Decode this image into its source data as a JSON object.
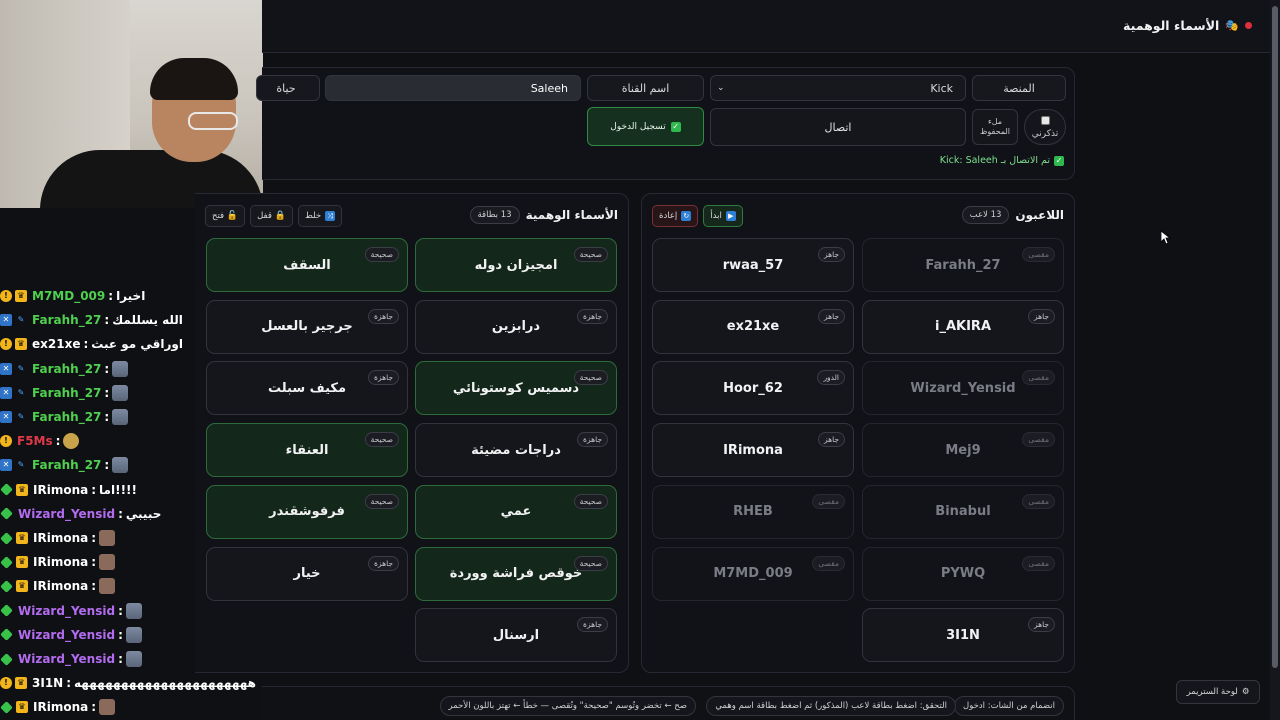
{
  "app": {
    "title": "الأسماء الوهمية"
  },
  "controls": {
    "platform_label": "المنصة",
    "platform_value": "Kick",
    "channel_label": "اسم القناة",
    "channel_value": "Saleeh",
    "clipped_field": "حياة",
    "remember_label": "تذكرني",
    "autosave_label": "ملء المحفوظ",
    "connect_label": "اتصال",
    "login_label": "تسجيل الدخول",
    "status": "تم الاتصال بـ Kick: Saleeh"
  },
  "players_panel": {
    "title": "اللاعبون",
    "count": "13 لاعب",
    "start_label": "ابدأ",
    "reset_label": "إعادة",
    "cards": [
      {
        "name": "Farahh_27",
        "status": "مقصى",
        "state": "faded"
      },
      {
        "name": "rwaa_57",
        "status": "جاهز",
        "state": "normal"
      },
      {
        "name": "i_AKIRA",
        "status": "جاهز",
        "state": "normal"
      },
      {
        "name": "ex21xe",
        "status": "جاهز",
        "state": "normal"
      },
      {
        "name": "Wizard_Yensid",
        "status": "مقصى",
        "state": "faded"
      },
      {
        "name": "Hoor_62",
        "status": "الدور",
        "state": "normal"
      },
      {
        "name": "Mej9",
        "status": "مقصى",
        "state": "faded"
      },
      {
        "name": "IRimona",
        "status": "جاهز",
        "state": "normal"
      },
      {
        "name": "Binabul",
        "status": "مقصى",
        "state": "faded"
      },
      {
        "name": "RHEB",
        "status": "مقصى",
        "state": "faded"
      },
      {
        "name": "PYWQ",
        "status": "مقصى",
        "state": "faded"
      },
      {
        "name": "M7MD_009",
        "status": "مقصى",
        "state": "faded"
      },
      {
        "name": "3I1N",
        "status": "جاهز",
        "state": "normal"
      }
    ]
  },
  "names_panel": {
    "title": "الأسماء الوهمية",
    "count": "13 بطاقة",
    "shuffle_label": "خلط",
    "lock_label": "قفل",
    "open_label": "فتح",
    "cards": [
      {
        "name": "امجيزان دوله",
        "status": "صحيحة",
        "state": "correct"
      },
      {
        "name": "السقف",
        "status": "صحيحة",
        "state": "correct"
      },
      {
        "name": "درابزين",
        "status": "جاهزة",
        "state": "normal"
      },
      {
        "name": "جرجير بالعسل",
        "status": "جاهزة",
        "state": "normal"
      },
      {
        "name": "دسميس كوستونائي",
        "status": "صحيحة",
        "state": "correct"
      },
      {
        "name": "مكيف سبلت",
        "status": "جاهزة",
        "state": "normal"
      },
      {
        "name": "دراجات مضيئة",
        "status": "جاهزة",
        "state": "normal"
      },
      {
        "name": "العنقاء",
        "status": "صحيحة",
        "state": "correct"
      },
      {
        "name": "عمي",
        "status": "صحيحة",
        "state": "correct"
      },
      {
        "name": "فرفوشقندر",
        "status": "صحيحة",
        "state": "correct"
      },
      {
        "name": "خوقص فراشة ووردة",
        "status": "صحيحة",
        "state": "correct"
      },
      {
        "name": "خيار",
        "status": "جاهزة",
        "state": "normal"
      },
      {
        "name": "ارسنال",
        "status": "جاهزة",
        "state": "normal"
      }
    ]
  },
  "help": {
    "join": "انضمام من الشات: ادخول",
    "verify": "التحقق: اضغط بطاقة لاعب (المذكور) ثم اضغط بطاقة اسم وهمي",
    "result": "صح ← تخضر وتُوسم \"صحيحة\" وتُقصى — خطأ ← تهتز باللون الأحمر"
  },
  "stream_panel_label": "لوحة الستريمر",
  "chat": [
    {
      "user": "M7MD_009",
      "msg": "اخيرا",
      "color": "#4fd04f",
      "badges": [
        "gold",
        "crown"
      ]
    },
    {
      "user": "Farahh_27",
      "msg": "الله يسللمك",
      "color": "#4fd04f",
      "badges": [
        "blue",
        "mute"
      ]
    },
    {
      "user": "ex21xe",
      "msg": "اوراقي مو عبث",
      "color": "#ffffff",
      "badges": [
        "gold",
        "crown"
      ]
    },
    {
      "user": "Farahh_27",
      "msg": "",
      "color": "#4fd04f",
      "badges": [
        "blue",
        "mute"
      ],
      "emote": "guy"
    },
    {
      "user": "Farahh_27",
      "msg": "",
      "color": "#4fd04f",
      "badges": [
        "blue",
        "mute"
      ],
      "emote": "guy"
    },
    {
      "user": "Farahh_27",
      "msg": "",
      "color": "#4fd04f",
      "badges": [
        "blue",
        "mute"
      ],
      "emote": "guy"
    },
    {
      "user": "F5Ms",
      "msg": "",
      "color": "#e03a4a",
      "badges": [
        "gold"
      ],
      "emote": "cry"
    },
    {
      "user": "Farahh_27",
      "msg": "",
      "color": "#4fd04f",
      "badges": [
        "blue",
        "mute"
      ],
      "emote": "guy"
    },
    {
      "user": "IRimona",
      "msg": "اما!!!!",
      "color": "#ffffff",
      "badges": [
        "green",
        "crown"
      ]
    },
    {
      "user": "Wizard_Yensid",
      "msg": "حبيبي",
      "color": "#b36cf0",
      "badges": [
        "green"
      ]
    },
    {
      "user": "IRimona",
      "msg": "",
      "color": "#ffffff",
      "badges": [
        "green",
        "crown"
      ],
      "emote": "face"
    },
    {
      "user": "IRimona",
      "msg": "",
      "color": "#ffffff",
      "badges": [
        "green",
        "crown"
      ],
      "emote": "face"
    },
    {
      "user": "IRimona",
      "msg": "",
      "color": "#ffffff",
      "badges": [
        "green",
        "crown"
      ],
      "emote": "face"
    },
    {
      "user": "Wizard_Yensid",
      "msg": "",
      "color": "#b36cf0",
      "badges": [
        "green"
      ],
      "emote": "guy"
    },
    {
      "user": "Wizard_Yensid",
      "msg": "",
      "color": "#b36cf0",
      "badges": [
        "green"
      ],
      "emote": "guy"
    },
    {
      "user": "Wizard_Yensid",
      "msg": "",
      "color": "#b36cf0",
      "badges": [
        "green"
      ],
      "emote": "guy"
    },
    {
      "user": "3I1N",
      "msg": "ههههههههههههههههههههههه",
      "color": "#ffffff",
      "badges": [
        "gold",
        "crown"
      ]
    },
    {
      "user": "IRimona",
      "msg": "",
      "color": "#ffffff",
      "badges": [
        "green",
        "crown"
      ],
      "emote": "face"
    }
  ]
}
